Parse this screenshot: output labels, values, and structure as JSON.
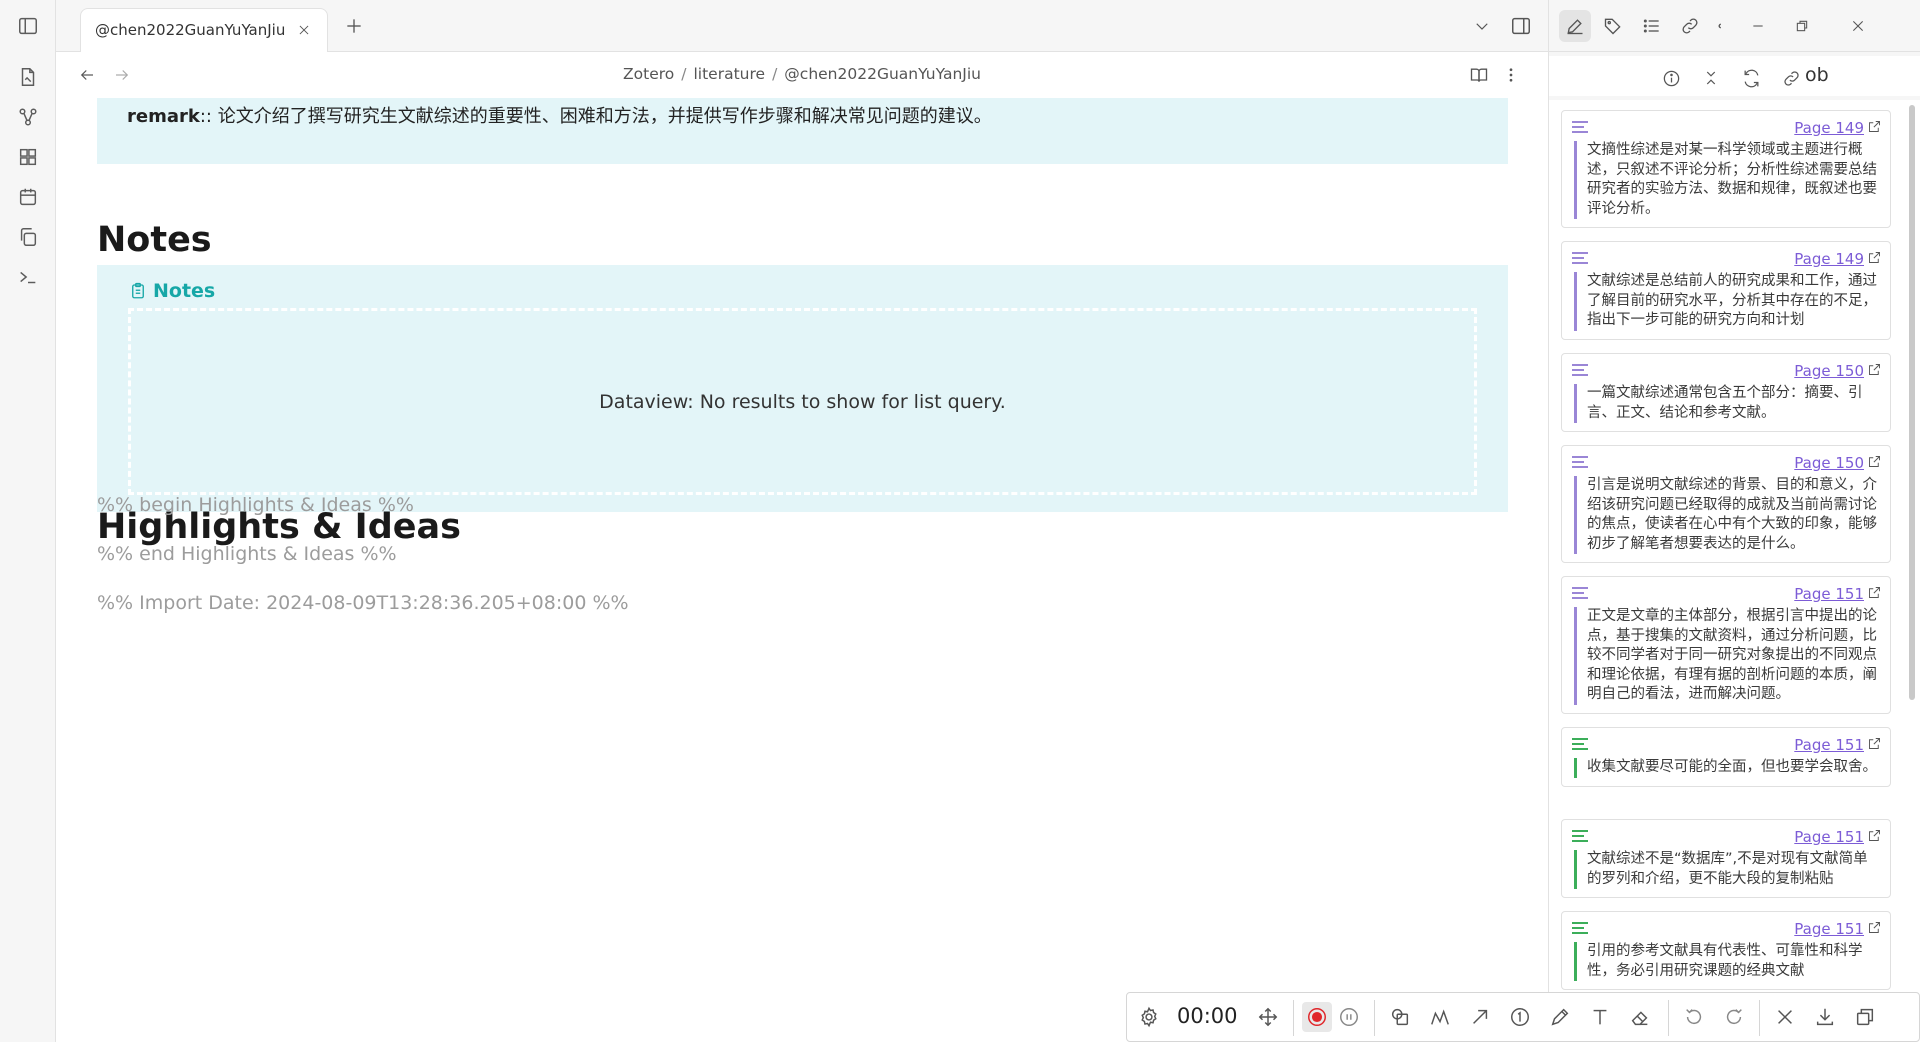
{
  "tabbar": {
    "tab_title": "@chen2022GuanYuYanJiu"
  },
  "breadcrumb": [
    "Zotero",
    "literature",
    "@chen2022GuanYuYanJiu"
  ],
  "note": {
    "remark_key": "remark",
    "remark_sep": "::",
    "remark_text": "论文介绍了撰写研究生文献综述的重要性、困难和方法，并提供写作步骤和解决常见问题的建议。",
    "notes_heading": "Notes",
    "notes_callout_label": "Notes",
    "dataview_message": "Dataview: No results to show for list query.",
    "highlights_heading": "Highlights & Ideas",
    "comment_begin": "%% begin Highlights & Ideas %%",
    "comment_end": "%% end Highlights & Ideas %%",
    "comment_import": "%% Import Date: 2024-08-09T13:28:36.205+08:00 %%"
  },
  "right_panel": {
    "toolbar_text": "ob",
    "annotations": [
      {
        "page": "Page 149",
        "color": "purple",
        "text": "文摘性综述是对某一科学领域或主题进行概述，只叙述不评论分析；分析性综述需要总结研究者的实验方法、数据和规律，既叙述也要评论分析。"
      },
      {
        "page": "Page 149",
        "color": "purple",
        "text": "文献综述是总结前人的研究成果和工作，通过了解目前的研究水平，分析其中存在的不足，指出下一步可能的研究方向和计划"
      },
      {
        "page": "Page 150",
        "color": "purple",
        "text": "一篇文献综述通常包含五个部分：摘要、引言、正文、结论和参考文献。"
      },
      {
        "page": "Page 150",
        "color": "purple",
        "text": "引言是说明文献综述的背景、目的和意义，介绍该研究问题已经取得的成就及当前尚需讨论的焦点，使读者在心中有个大致的印象，能够初步了解笔者想要表达的是什么。"
      },
      {
        "page": "Page 151",
        "color": "purple",
        "text": "正文是文章的主体部分，根据引言中提出的论点，基于搜集的文献资料，通过分析问题，比较不同学者对于同一研究对象提出的不同观点和理论依据，有理有据的剖析问题的本质，阐明自己的看法，进而解决问题。"
      },
      {
        "page": "Page 151",
        "color": "green",
        "text": "收集文献要尽可能的全面，但也要学会取舍。"
      },
      {
        "page": "Page 151",
        "color": "green",
        "text": "文献综述不是“数据库”,不是对现有文献简单的罗列和介绍，更不能大段的复制粘贴"
      },
      {
        "page": "Page 151",
        "color": "green",
        "text": "引用的参考文献具有代表性、可靠性和科学性，务必引用研究课题的经典文献"
      }
    ]
  },
  "draw_toolbar": {
    "timer": "00:00"
  },
  "colors": {
    "callout_bg": "#e3f5f8",
    "callout_accent": "#16a7a7",
    "annotation_purple": "#9a86d6",
    "annotation_green": "#3cae5a",
    "record_red": "#e0262a"
  }
}
